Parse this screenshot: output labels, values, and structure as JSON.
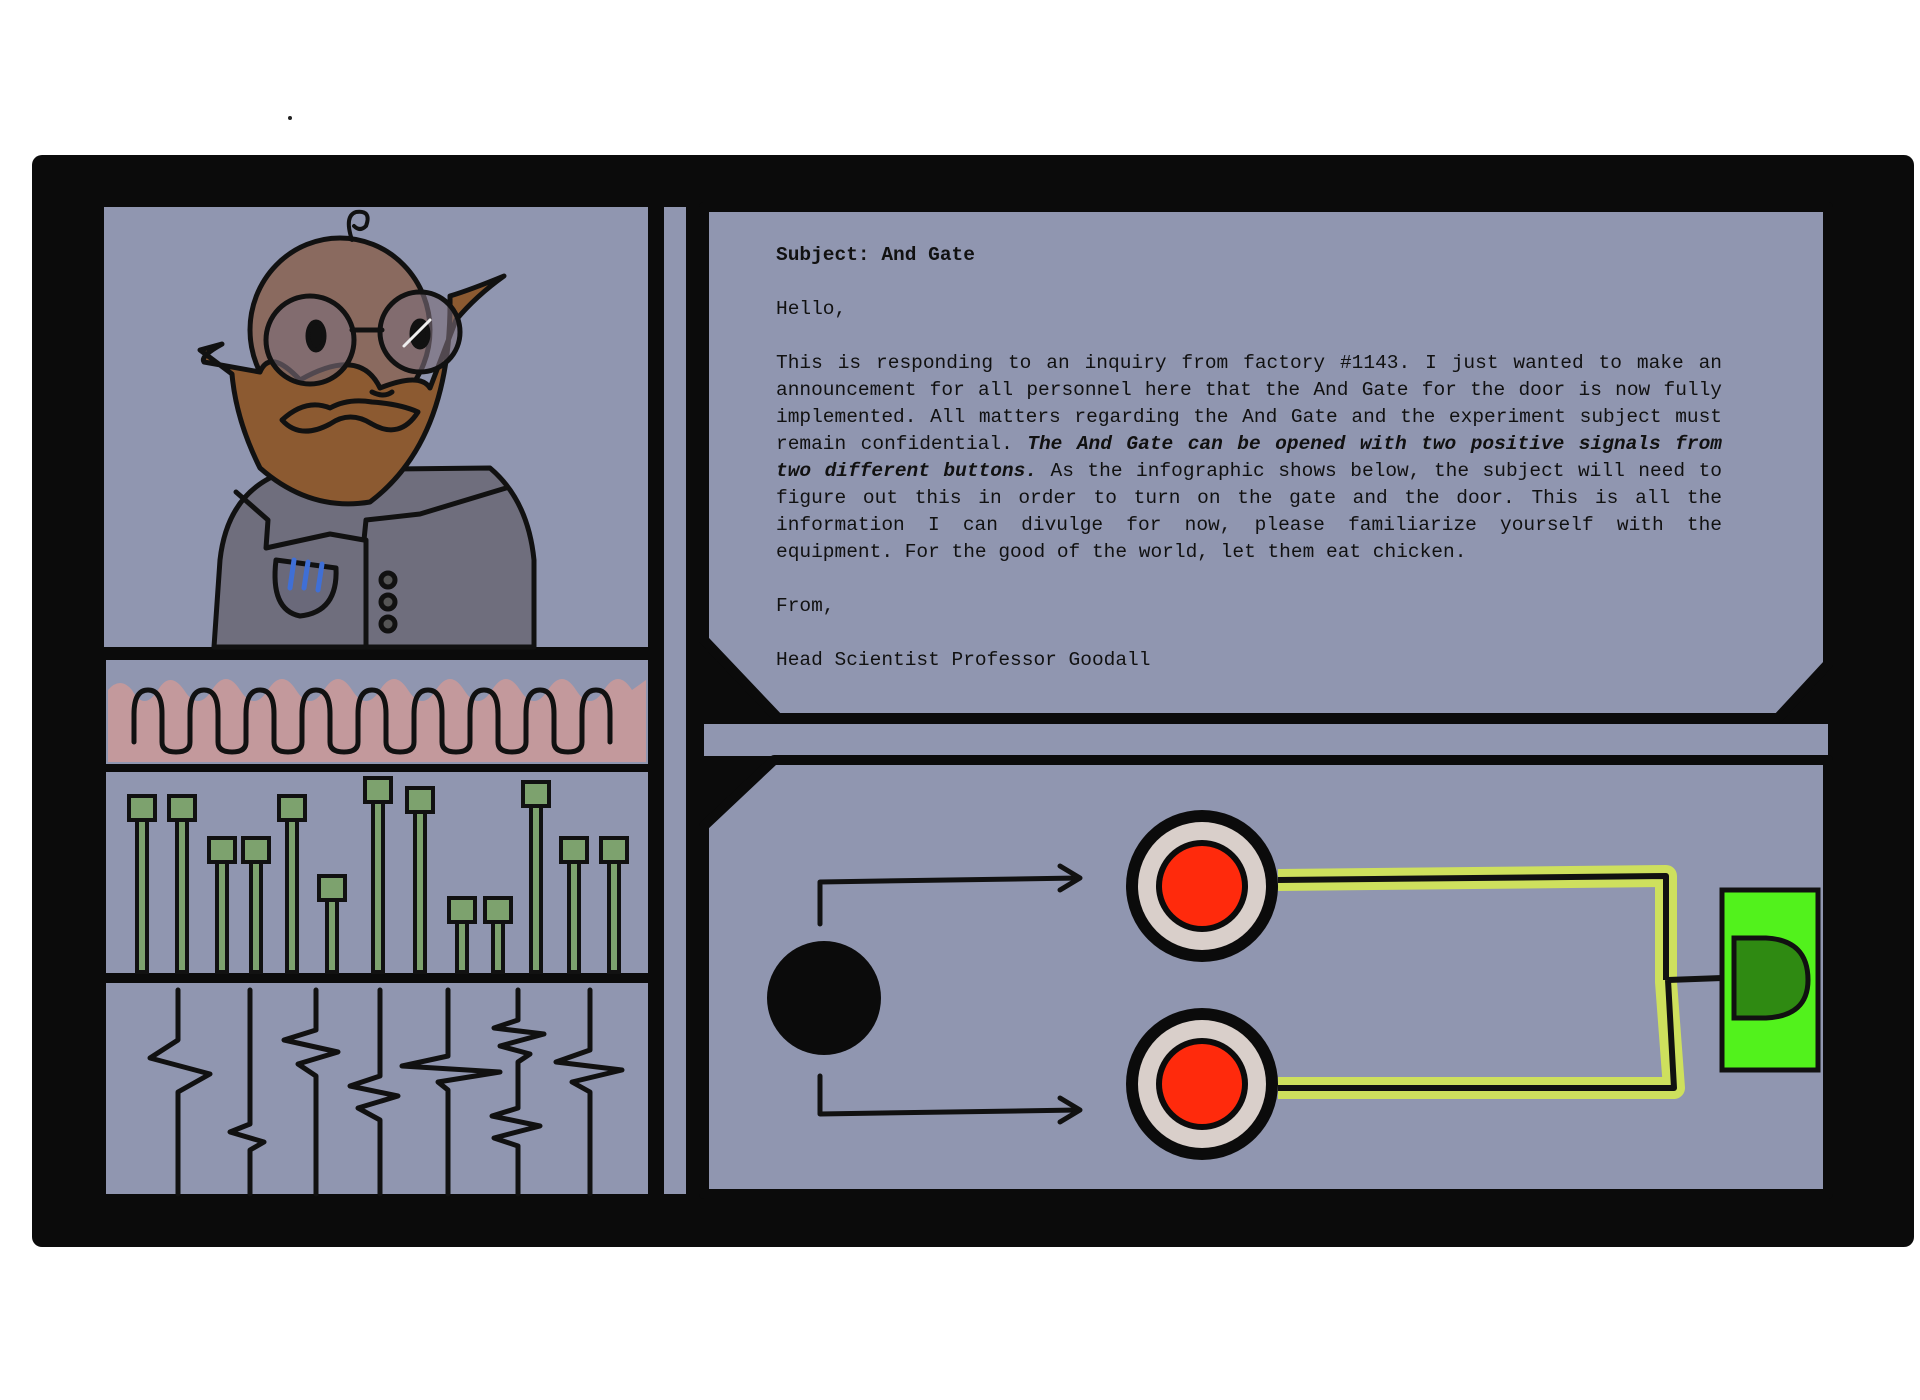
{
  "colors": {
    "frame": "#0b0b0b",
    "panel": "#9096b0",
    "wave_band": "#c3999c",
    "slider": "#7da26e",
    "scientist_skin": "#8a6a5f",
    "beard": "#8c5a31",
    "coat": "#6f6e7d",
    "button_ring": "#d9cfca",
    "button_red": "#ff2a0c",
    "wire_glow": "#e8ff3a",
    "gate_box": "#52f21c",
    "gate_shape": "#2f8a12"
  },
  "icons": {
    "scientist": "scientist-portrait-icon",
    "signal_source": "signal-source-dot-icon",
    "button": "red-push-button-icon",
    "gate": "and-gate-icon"
  },
  "message": {
    "subject": "Subject: And Gate",
    "greeting": "Hello,",
    "body_part1": "This is responding to an inquiry from factory #1143. I just wanted to make an announcement for all personnel here that the And Gate for the door is now fully implemented. All matters regarding the And Gate and the experiment subject must remain confidential. ",
    "body_emphasis": "The And Gate can be opened with two positive signals from two different buttons.",
    "body_part2": " As the infographic shows below, the subject will need to figure out this in order to turn on the gate and the door. This is all the information I can divulge for now, please familiarize yourself with the equipment. For the good of the world, let them eat chicken.",
    "closing": "From,",
    "signature": "Head Scientist Professor Goodall"
  }
}
